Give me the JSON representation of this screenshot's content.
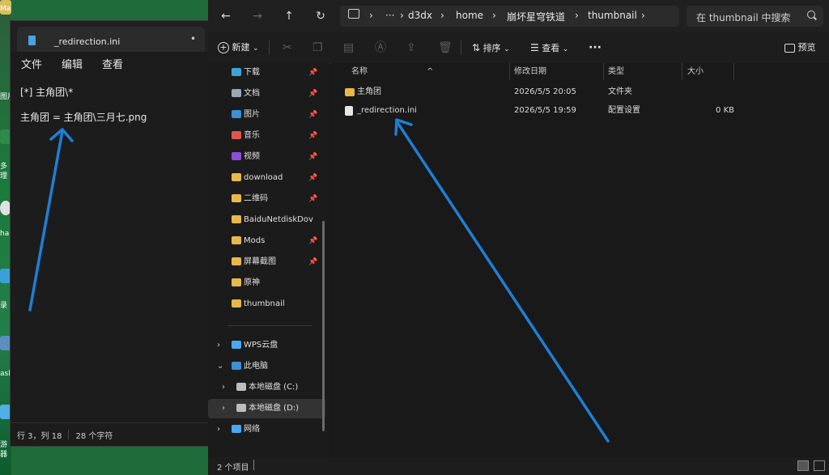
{
  "desktop": {
    "fragments": [
      "Ma",
      "图片",
      "多",
      "理",
      "ha",
      "录",
      "ask",
      "游",
      "器"
    ]
  },
  "notepad": {
    "tab_title": "_redirection.ini",
    "tab_dot": "•",
    "menu": [
      "文件",
      "编辑",
      "查看"
    ],
    "lines": [
      "[*] 主角团\\*",
      "主角团 = 主角团\\三月七.png"
    ],
    "status_position": "行 3，列 18",
    "status_chars": "28 个字符"
  },
  "explorer": {
    "nav_buttons": [
      "←",
      "→",
      "↑",
      "↻"
    ],
    "breadcrumb": [
      "d3dx",
      "home",
      "崩坏星穹铁道",
      "thumbnail"
    ],
    "breadcrumb_more": "···",
    "search_placeholder": "在 thumbnail 中搜索",
    "toolbar": {
      "new_label": "新建",
      "sort_label": "排序",
      "view_label": "查看",
      "more_label": "···",
      "preview_label": "预览"
    },
    "nav_items": [
      {
        "label": "下载",
        "pinned": true,
        "icon": "download-icon",
        "color": "#3fa3d6"
      },
      {
        "label": "文档",
        "pinned": true,
        "icon": "document-icon",
        "color": "#9aa7b5"
      },
      {
        "label": "图片",
        "pinned": true,
        "icon": "picture-icon",
        "color": "#3d8fd6"
      },
      {
        "label": "音乐",
        "pinned": true,
        "icon": "music-icon",
        "color": "#e0564a"
      },
      {
        "label": "视频",
        "pinned": true,
        "icon": "video-icon",
        "color": "#8d4fd6"
      },
      {
        "label": "download",
        "pinned": true,
        "icon": "folder-icon",
        "color": "#e8b84a"
      },
      {
        "label": "二维码",
        "pinned": true,
        "icon": "folder-icon",
        "color": "#e8b84a"
      },
      {
        "label": "BaiduNetdiskDov",
        "pinned": false,
        "icon": "folder-icon",
        "color": "#e8b84a"
      },
      {
        "label": "Mods",
        "pinned": true,
        "icon": "folder-icon",
        "color": "#e8b84a"
      },
      {
        "label": "屏幕截图",
        "pinned": true,
        "icon": "folder-icon",
        "color": "#e8b84a"
      },
      {
        "label": "原神",
        "pinned": false,
        "icon": "folder-icon",
        "color": "#e8b84a"
      },
      {
        "label": "thumbnail",
        "pinned": false,
        "icon": "folder-icon",
        "color": "#e8b84a"
      }
    ],
    "nav_tree": [
      {
        "label": "WPS云盘",
        "icon": "cloud-icon",
        "color": "#4aa8f0"
      },
      {
        "label": "此电脑",
        "icon": "computer-icon",
        "color": "#3d8fd6"
      },
      {
        "label": "本地磁盘 (C:)",
        "icon": "drive-c-icon",
        "color": "#bdbdbd"
      },
      {
        "label": "本地磁盘 (D:)",
        "icon": "drive-d-icon",
        "color": "#bdbdbd"
      },
      {
        "label": "网络",
        "icon": "network-icon",
        "color": "#4aa8f0"
      }
    ],
    "columns": [
      "名称",
      "修改日期",
      "类型",
      "大小"
    ],
    "files": [
      {
        "name": "主角团",
        "date": "2026/5/5 20:05",
        "type": "文件夹",
        "size": "",
        "icon": "folder-icon"
      },
      {
        "name": "_redirection.ini",
        "date": "2026/5/5 19:59",
        "type": "配置设置",
        "size": "0 KB",
        "icon": "ini-file-icon"
      }
    ],
    "status_count": "2 个项目"
  }
}
